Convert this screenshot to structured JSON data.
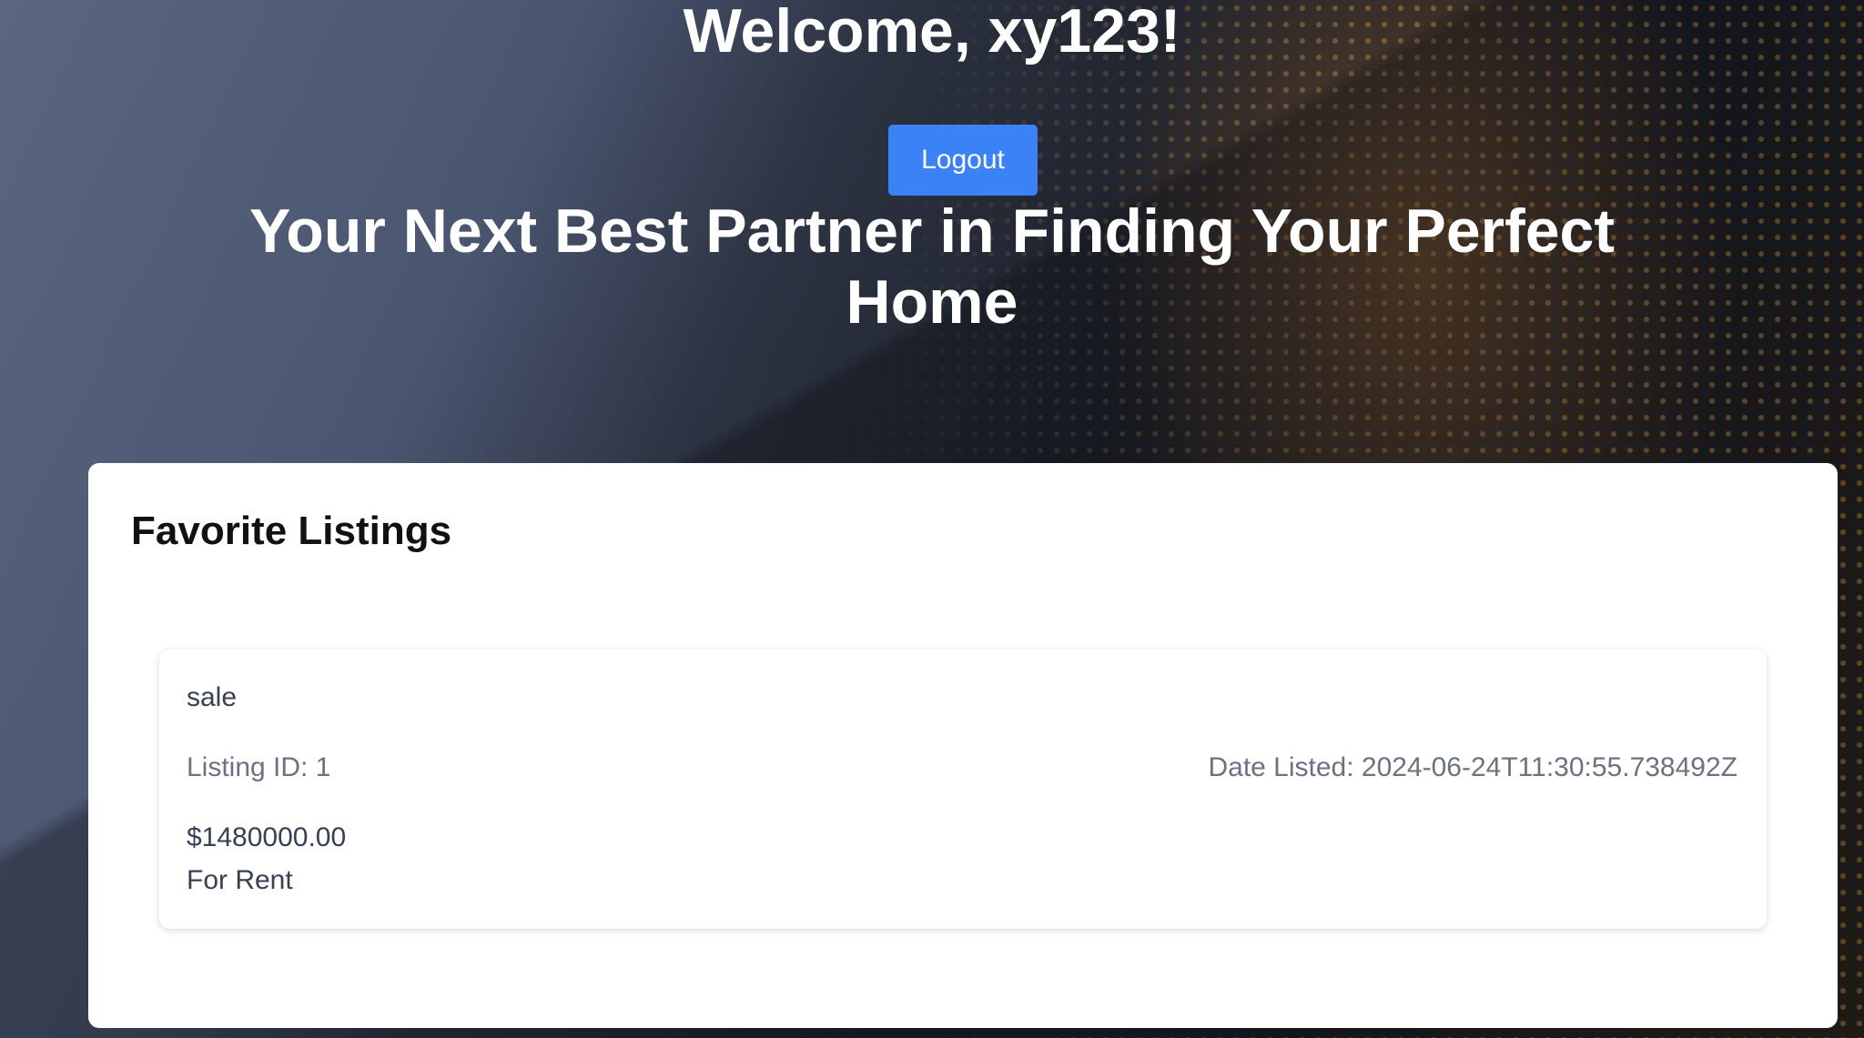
{
  "header": {
    "welcome": "Welcome, xy123!",
    "logout_label": "Logout",
    "headline": "Your Next Best Partner in Finding Your Perfect Home"
  },
  "favorites": {
    "title": "Favorite Listings",
    "listings": [
      {
        "type": "sale",
        "listing_id": "Listing ID: 1",
        "date_listed": "Date Listed: 2024-06-24T11:30:55.738492Z",
        "price": "$1480000.00",
        "status": "For Rent"
      }
    ]
  },
  "colors": {
    "accent": "#3b82f6",
    "panel": "#ffffff"
  }
}
